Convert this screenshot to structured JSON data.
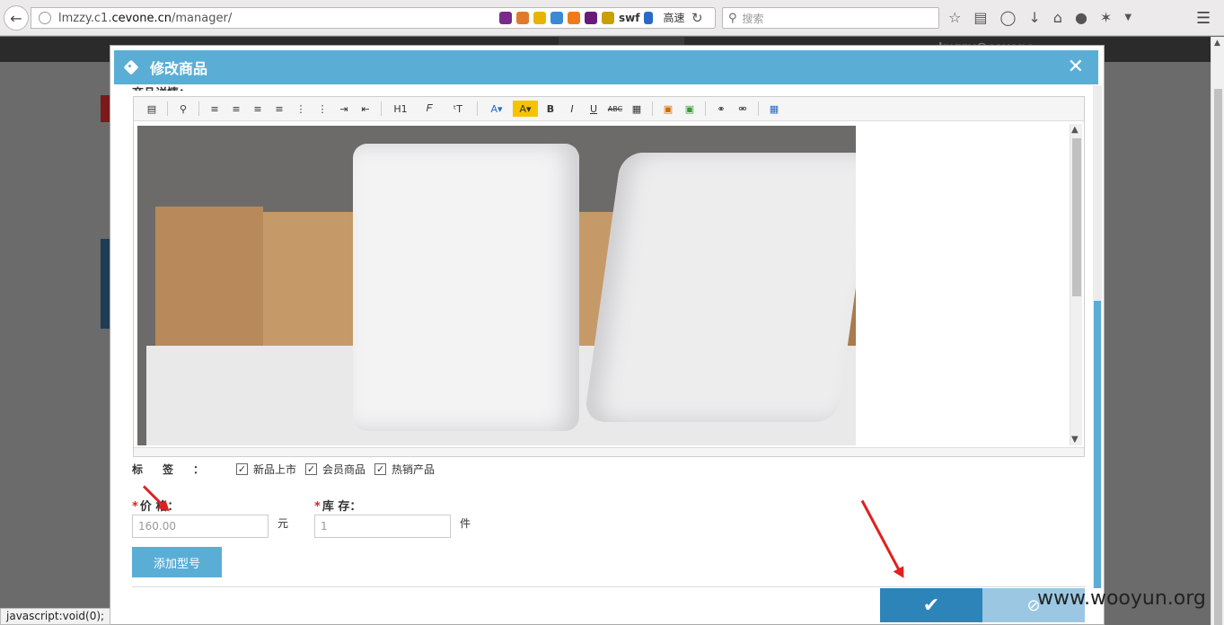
{
  "browser": {
    "url_prefix": "lmzzy.c1.",
    "url_domain": "cevone.cn",
    "url_path": "/manager/",
    "addon_swf": "swf",
    "addon_speed": "高速",
    "search_placeholder": "搜索"
  },
  "site": {
    "user_email": "lmzzy@cevone..."
  },
  "modal": {
    "title": "修改商品",
    "cut_label": "商品详情：",
    "tags_label": "标签：",
    "tags": [
      {
        "label": "新品上市",
        "checked": true
      },
      {
        "label": "会员商品",
        "checked": true
      },
      {
        "label": "热销产品",
        "checked": true
      }
    ],
    "price_label": "价  格：",
    "price_value": "160.00",
    "price_unit": "元",
    "stock_label": "库  存：",
    "stock_value": "1",
    "stock_unit": "件",
    "add_model_label": "添加型号"
  },
  "editor": {
    "toolbar": [
      "source",
      "preview",
      "align-left",
      "align-center",
      "align-right",
      "justify",
      "ordered-list",
      "unordered-list",
      "indent",
      "outdent",
      "H1",
      "font",
      "font-size",
      "font-color",
      "highlight",
      "B",
      "I",
      "U",
      "ABC",
      "table-grid",
      "image",
      "multi-image",
      "link",
      "unlink",
      "table"
    ]
  },
  "status_bar": "javascript:void(0);",
  "watermark": "www.wooyun.org"
}
